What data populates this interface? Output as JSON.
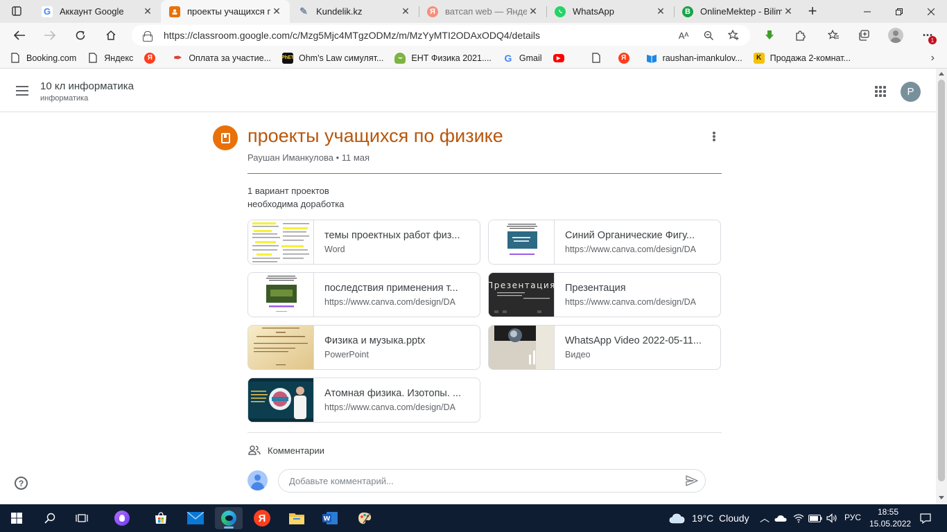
{
  "browser": {
    "tabs": [
      {
        "label": "Аккаунт Google",
        "icon": "google-g-icon",
        "active": false
      },
      {
        "label": "проекты учащихся по физике",
        "icon": "classroom-icon",
        "active": true
      },
      {
        "label": "Kundelik.kz",
        "icon": "kundelik-icon",
        "active": false
      },
      {
        "label": "ватсап web — Яндекс",
        "icon": "yandex-icon",
        "active": false
      },
      {
        "label": "WhatsApp",
        "icon": "whatsapp-icon",
        "active": false
      },
      {
        "label": "OnlineMektep - BilimLand",
        "icon": "onlinemektep-icon",
        "active": false
      }
    ],
    "new_tab": "+",
    "url": "https://classroom.google.com/c/Mzg5Mjc4MTgzODMz/m/MzYyMTI2ODAxODQ4/details",
    "read_aloud": "Aᴬ",
    "notification_badge": "1",
    "bookmarks": [
      {
        "label": "Booking.com",
        "icon": "page-icon"
      },
      {
        "label": "Яндекс",
        "icon": "page-icon"
      },
      {
        "label": "",
        "icon": "yandex-icon"
      },
      {
        "label": "Оплата за участие...",
        "icon": "feather-icon"
      },
      {
        "label": "Ohm's Law симулят...",
        "icon": "phet-icon"
      },
      {
        "label": "ЕНТ Физика 2021....",
        "icon": "ent-icon"
      },
      {
        "label": "Gmail",
        "icon": "google-g-icon"
      },
      {
        "label": "",
        "icon": "youtube-icon"
      },
      {
        "label": "",
        "icon": "page-icon"
      },
      {
        "label": "",
        "icon": "yandex-icon"
      },
      {
        "label": "raushan-imankulov...",
        "icon": "book-icon"
      },
      {
        "label": "Продажа 2-комнат...",
        "icon": "krisha-icon"
      }
    ]
  },
  "header": {
    "course_title": "10 кл информатика",
    "course_subtitle": "информатика",
    "avatar_letter": "P"
  },
  "assignment": {
    "title": "проекты учащихся по физике",
    "meta": "Раушан Иманкулова • 11 мая",
    "description_line1": "1 вариант проектов",
    "description_line2": "необходима доработка",
    "accent_color": "#b8570d"
  },
  "attachments": [
    {
      "title": "темы проектных работ физ...",
      "subtitle": "Word",
      "thumb": "word-doc"
    },
    {
      "title": "Синий Органические Фигу...",
      "subtitle": "https://www.canva.com/design/DA",
      "thumb": "canva-blue"
    },
    {
      "title": "последствия применения т...",
      "subtitle": "https://www.canva.com/design/DA",
      "thumb": "canva-green"
    },
    {
      "title": "Презентация",
      "subtitle": "https://www.canva.com/design/DA",
      "thumb": "presentation-dark"
    },
    {
      "title": "Физика и музыка.pptx",
      "subtitle": "PowerPoint",
      "thumb": "pptx"
    },
    {
      "title": "WhatsApp Video 2022-05-11...",
      "subtitle": "Видео",
      "thumb": "video"
    },
    {
      "title": "Атомная физика. Изотопы. ...",
      "subtitle": "https://www.canva.com/design/DA",
      "thumb": "canva-atom"
    }
  ],
  "thumb_text": {
    "presentation": "Презентация"
  },
  "comments": {
    "label": "Комментарии",
    "placeholder": "Добавьте комментарий..."
  },
  "taskbar": {
    "weather_temp": "19°C",
    "weather_text": "Cloudy",
    "language": "РУС",
    "time": "18:55",
    "date": "15.05.2022"
  }
}
